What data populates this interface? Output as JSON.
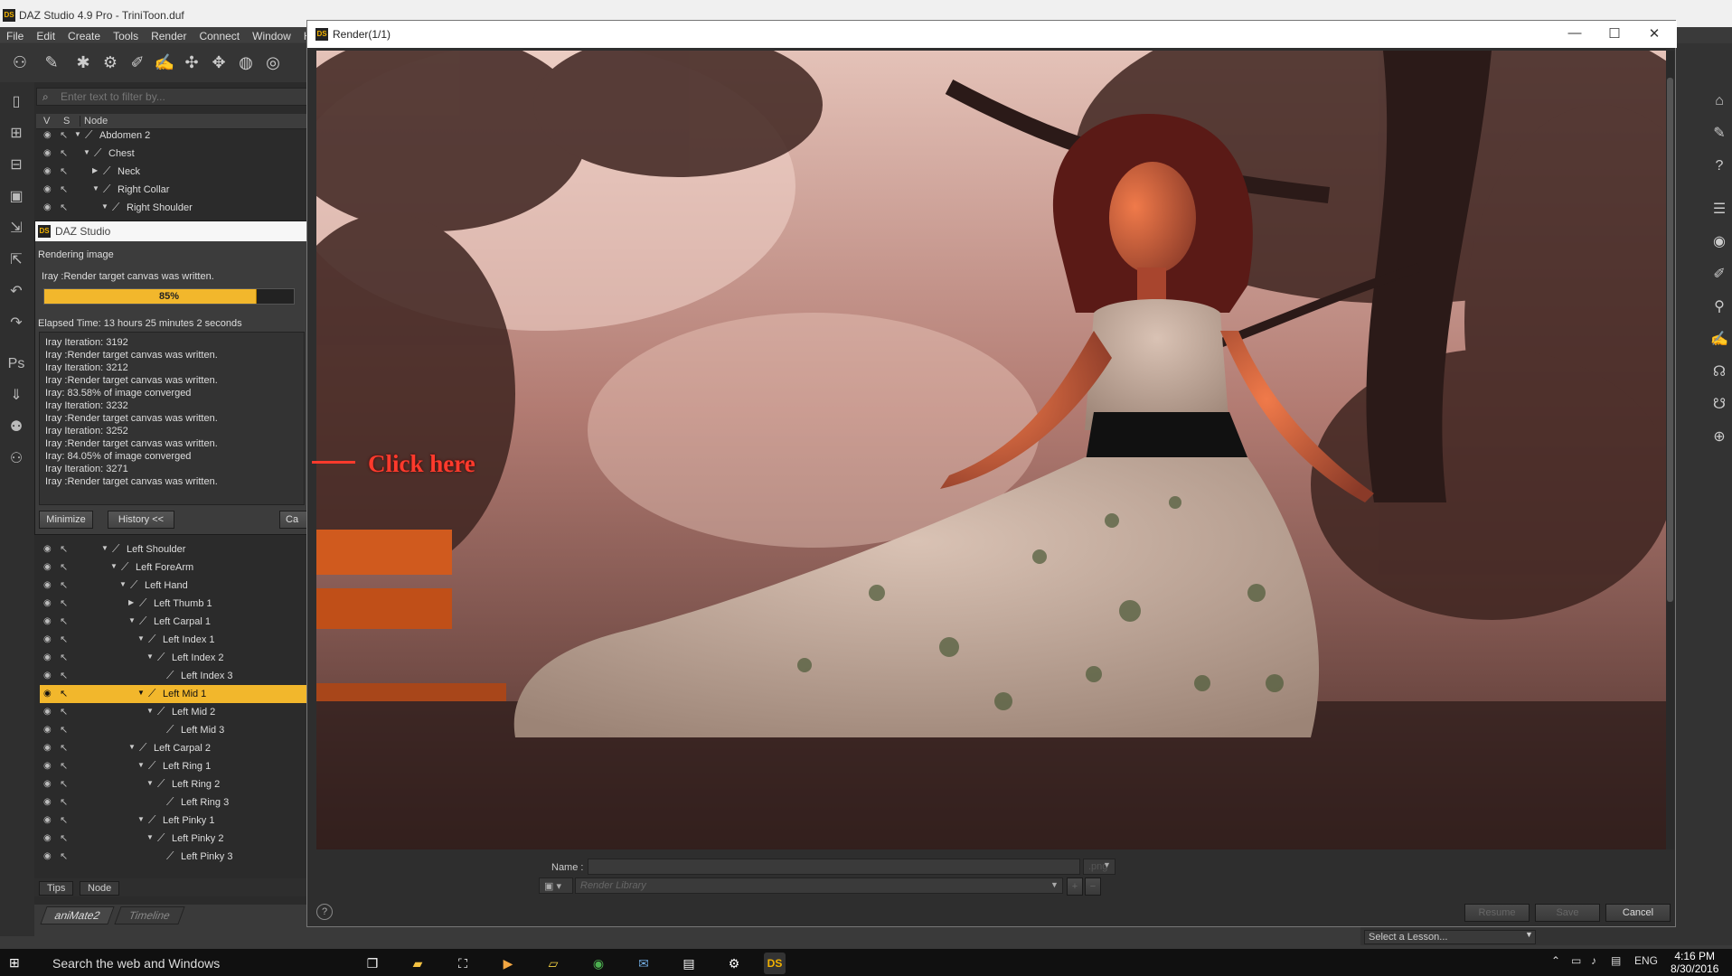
{
  "app": {
    "title": "DAZ Studio 4.9 Pro - TriniToon.duf",
    "logo": "DS",
    "menu": [
      "File",
      "Edit",
      "Create",
      "Tools",
      "Render",
      "Connect",
      "Window",
      "Help"
    ]
  },
  "scene": {
    "filter_placeholder": "Enter text to filter by...",
    "columns": {
      "v": "V",
      "s": "S",
      "node": "Node"
    },
    "rows_top": [
      {
        "label": "Abdomen 2",
        "depth": 1,
        "expanded": true
      },
      {
        "label": "Chest",
        "depth": 2,
        "expanded": true
      },
      {
        "label": "Neck",
        "depth": 3,
        "expanded": false
      },
      {
        "label": "Right Collar",
        "depth": 3,
        "expanded": true
      },
      {
        "label": "Right Shoulder",
        "depth": 4,
        "expanded": true
      }
    ],
    "rows_bottom": [
      {
        "label": "Left Shoulder",
        "depth": 4,
        "expanded": true
      },
      {
        "label": "Left ForeArm",
        "depth": 5,
        "expanded": true
      },
      {
        "label": "Left Hand",
        "depth": 6,
        "expanded": true
      },
      {
        "label": "Left Thumb 1",
        "depth": 7,
        "expanded": false
      },
      {
        "label": "Left Carpal 1",
        "depth": 7,
        "expanded": true
      },
      {
        "label": "Left Index 1",
        "depth": 8,
        "expanded": true
      },
      {
        "label": "Left Index 2",
        "depth": 9,
        "expanded": true
      },
      {
        "label": "Left Index 3",
        "depth": 10,
        "expanded": null
      },
      {
        "label": "Left Mid 1",
        "depth": 8,
        "expanded": true,
        "selected": true
      },
      {
        "label": "Left Mid 2",
        "depth": 9,
        "expanded": true
      },
      {
        "label": "Left Mid 3",
        "depth": 10,
        "expanded": null
      },
      {
        "label": "Left Carpal 2",
        "depth": 7,
        "expanded": true
      },
      {
        "label": "Left Ring 1",
        "depth": 8,
        "expanded": true
      },
      {
        "label": "Left Ring 2",
        "depth": 9,
        "expanded": true
      },
      {
        "label": "Left Ring 3",
        "depth": 10,
        "expanded": null
      },
      {
        "label": "Left Pinky 1",
        "depth": 8,
        "expanded": true
      },
      {
        "label": "Left Pinky 2",
        "depth": 9,
        "expanded": true
      },
      {
        "label": "Left Pinky 3",
        "depth": 10,
        "expanded": null
      }
    ],
    "bottom_tabs": [
      "Tips",
      "Node"
    ],
    "panel_tabs": [
      "aniMate2",
      "Timeline"
    ]
  },
  "progress_dialog": {
    "title": "DAZ Studio",
    "heading": "Rendering image",
    "status": "Iray :Render target canvas was written.",
    "percent": 85,
    "percent_label": "85%",
    "elapsed": "Elapsed Time:  13 hours 25 minutes 2 seconds",
    "log": [
      "Iray Iteration: 3192",
      "Iray :Render target canvas was written.",
      "Iray Iteration: 3212",
      "Iray :Render target canvas was written.",
      "Iray: 83.58% of image converged",
      "Iray Iteration: 3232",
      "Iray :Render target canvas was written.",
      "Iray Iteration: 3252",
      "Iray :Render target canvas was written.",
      "Iray: 84.05% of image converged",
      "Iray Iteration: 3271",
      "Iray :Render target canvas was written."
    ],
    "buttons": {
      "minimize": "Minimize",
      "history": "History <<",
      "cancel": "Ca"
    }
  },
  "render_window": {
    "title": "Render(1/1)",
    "name_label": "Name :",
    "name_value": "",
    "ext": ".png",
    "library_placeholder": "Render Library",
    "buttons": {
      "resume": "Resume",
      "save": "Save",
      "cancel": "Cancel"
    },
    "help": "?"
  },
  "annotation": {
    "text": "Click here",
    "color": "#ff3a2c"
  },
  "lesson_bar": {
    "placeholder": "Select a Lesson..."
  },
  "taskbar": {
    "search": "Search the web and Windows",
    "lang": "ENG",
    "time": "4:16 PM",
    "date": "8/30/2016",
    "apps": [
      "task-view-icon",
      "file-explorer-icon",
      "store-icon",
      "media-icon",
      "folder-icon",
      "chrome-icon",
      "thunderbird-icon",
      "photos-icon",
      "steam-icon",
      "daz-studio-icon"
    ]
  },
  "colors": {
    "accent": "#f2b72c",
    "panel": "#2b2b2b",
    "annotation": "#ff3a2c"
  }
}
